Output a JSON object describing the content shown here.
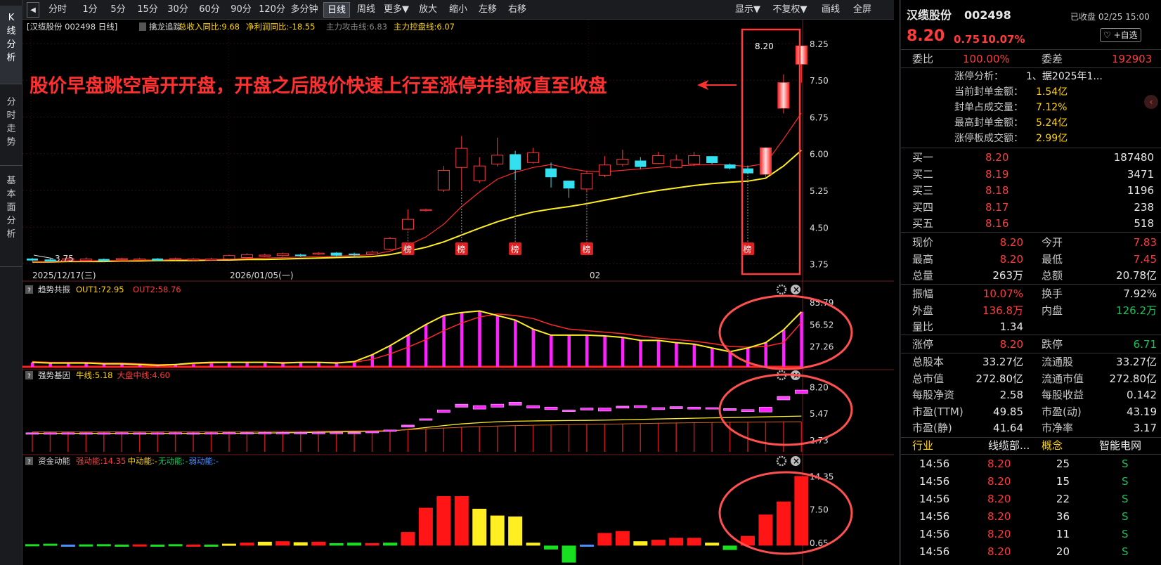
{
  "left_tabs": [
    "K线分析",
    "分时走势",
    "基本面分析"
  ],
  "toolbar": {
    "items": [
      "分时",
      "1分",
      "5分",
      "15分",
      "30分",
      "60分",
      "90分",
      "120分",
      "多分钟",
      "日线",
      "周线",
      "更多▼",
      "放大",
      "缩小",
      "左移",
      "右移"
    ],
    "active": "日线",
    "right_items": [
      "显示▼",
      "不复权▼",
      "画线",
      "全屏"
    ]
  },
  "panes": {
    "main": {
      "header_items": [
        {
          "text": "[汉缆股份 002498 日线]",
          "color": "#dddddd"
        },
        {
          "text": "擒龙追踪",
          "color": "#dddddd"
        },
        {
          "text": "总收入同比:9.68",
          "color": "#ffd400"
        },
        {
          "text": "净利润同比:-18.55",
          "color": "#ffd400"
        },
        {
          "text": "主力攻击线:6.83",
          "color": "#888888"
        },
        {
          "text": "主力控盘线:6.07",
          "color": "#ffd400"
        }
      ],
      "yticks": [
        "8.25",
        "7.50",
        "6.75",
        "6.00",
        "5.25",
        "4.50",
        "3.75"
      ],
      "dates": [
        "2025/12/17(三)",
        "2026/01/05(一)",
        "02"
      ],
      "annotation": "股价早盘跳空高开开盘，开盘之后股价快速上行至涨停并封板直至收盘",
      "last_price_label": "8.20",
      "low_label": "3.75",
      "bang_label": "榜"
    },
    "p1": {
      "name": "趋势共振",
      "v1": "OUT1:72.95",
      "v2": "OUT2:58.76",
      "yticks": [
        "85.79",
        "56.52",
        "27.26"
      ]
    },
    "p2": {
      "name": "强势基因",
      "v1": "牛线:5.18",
      "v2": "大盘中线:4.60",
      "yticks": [
        "8.20",
        "5.47",
        "2.73"
      ]
    },
    "p3": {
      "name": "资金动能",
      "v1": "强动能:14.35",
      "v2": "中动能:-",
      "v3": "无动能:-",
      "v4": "弱动能:-",
      "yticks": [
        "14.35",
        "7.50",
        "0.65"
      ]
    }
  },
  "chart_data": [
    {
      "type": "candlestick",
      "title": "汉缆股份 002498 日线",
      "x": [
        "2025-12-17",
        "2025-12-18",
        "2025-12-19",
        "2025-12-22",
        "2025-12-23",
        "2025-12-24",
        "2025-12-25",
        "2025-12-26",
        "2025-12-29",
        "2025-12-30",
        "2025-12-31",
        "2026-01-05",
        "2026-01-06",
        "2026-01-07",
        "2026-01-08",
        "2026-01-09",
        "2026-01-12",
        "2026-01-13",
        "2026-01-14",
        "2026-01-15",
        "2026-01-16",
        "2026-01-19",
        "2026-01-20",
        "2026-01-21",
        "2026-01-22",
        "2026-01-23",
        "2026-01-26",
        "2026-01-27",
        "2026-01-28",
        "2026-01-29",
        "2026-01-30",
        "2026-02-02",
        "2026-02-03",
        "2026-02-04",
        "2026-02-05",
        "2026-02-06",
        "2026-02-09",
        "2026-02-10",
        "2026-02-11",
        "2026-02-12",
        "2026-02-13",
        "2026-02-23",
        "2026-02-24",
        "2026-02-25"
      ],
      "open": [
        3.86,
        3.84,
        3.83,
        3.82,
        3.85,
        3.84,
        3.84,
        3.86,
        3.85,
        3.84,
        3.83,
        3.85,
        3.88,
        3.91,
        3.92,
        3.94,
        3.95,
        3.98,
        3.96,
        3.95,
        4.05,
        4.46,
        4.84,
        5.26,
        5.72,
        5.45,
        5.79,
        5.99,
        5.82,
        5.7,
        5.45,
        5.28,
        5.56,
        5.78,
        5.86,
        5.8,
        5.72,
        5.79,
        5.95,
        5.78,
        5.7,
        5.58,
        6.93,
        7.83
      ],
      "close": [
        3.82,
        3.8,
        3.86,
        3.85,
        3.81,
        3.86,
        3.85,
        3.82,
        3.86,
        3.85,
        3.85,
        3.92,
        3.94,
        3.93,
        3.96,
        3.91,
        3.97,
        3.92,
        3.93,
        3.99,
        4.27,
        4.66,
        4.86,
        5.66,
        6.11,
        5.75,
        5.97,
        5.67,
        6.02,
        5.52,
        5.29,
        5.6,
        5.77,
        5.89,
        5.73,
        5.96,
        5.87,
        5.96,
        5.81,
        5.7,
        5.6,
        6.12,
        7.45,
        8.2
      ],
      "high": [
        3.87,
        3.86,
        3.88,
        3.88,
        3.86,
        3.88,
        3.87,
        3.87,
        3.88,
        3.87,
        3.87,
        3.94,
        3.97,
        3.96,
        3.98,
        3.96,
        3.99,
        3.99,
        3.98,
        4.02,
        4.3,
        4.86,
        4.88,
        5.75,
        6.36,
        5.93,
        6.33,
        6.06,
        6.12,
        5.82,
        5.43,
        5.65,
        5.95,
        6.08,
        5.93,
        6.04,
        5.98,
        6.04,
        5.95,
        5.8,
        5.76,
        6.13,
        7.62,
        8.2
      ],
      "low": [
        3.8,
        3.78,
        3.81,
        3.81,
        3.79,
        3.82,
        3.82,
        3.8,
        3.82,
        3.81,
        3.81,
        3.83,
        3.86,
        3.89,
        3.9,
        3.89,
        3.93,
        3.9,
        3.91,
        3.93,
        4.03,
        4.44,
        4.82,
        5.22,
        5.25,
        5.4,
        5.74,
        5.46,
        5.8,
        5.31,
        5.1,
        5.21,
        5.52,
        5.74,
        5.68,
        5.79,
        5.7,
        5.75,
        5.79,
        5.68,
        5.58,
        5.53,
        6.82,
        7.45
      ],
      "ma_fast": [
        3.8,
        3.8,
        3.81,
        3.81,
        3.82,
        3.82,
        3.83,
        3.83,
        3.84,
        3.84,
        3.84,
        3.85,
        3.86,
        3.87,
        3.88,
        3.89,
        3.9,
        3.91,
        3.92,
        3.94,
        4.01,
        4.13,
        4.3,
        4.56,
        4.92,
        5.22,
        5.48,
        5.62,
        5.72,
        5.78,
        5.7,
        5.64,
        5.63,
        5.66,
        5.69,
        5.72,
        5.75,
        5.77,
        5.78,
        5.77,
        5.74,
        5.8,
        6.3,
        6.83
      ],
      "ma_slow": [
        3.79,
        3.79,
        3.8,
        3.8,
        3.8,
        3.81,
        3.81,
        3.82,
        3.82,
        3.82,
        3.83,
        3.83,
        3.84,
        3.84,
        3.85,
        3.86,
        3.87,
        3.88,
        3.89,
        3.9,
        3.94,
        4.01,
        4.09,
        4.2,
        4.34,
        4.48,
        4.61,
        4.72,
        4.81,
        4.87,
        4.92,
        4.98,
        5.05,
        5.12,
        5.19,
        5.25,
        5.3,
        5.35,
        5.39,
        5.42,
        5.44,
        5.5,
        5.75,
        6.07
      ],
      "bang_indices": [
        21,
        24,
        27,
        31,
        40
      ],
      "ylim": [
        3.6,
        8.45
      ],
      "yticks": [
        8.25,
        7.5,
        6.75,
        6.0,
        5.25,
        4.5,
        3.75
      ]
    },
    {
      "type": "bar",
      "title": "趋势共振",
      "series": [
        {
          "name": "OUT1",
          "values": [
            6,
            5,
            5,
            5,
            4,
            4,
            3,
            2,
            3,
            5,
            6,
            6,
            6,
            6,
            5,
            6,
            6,
            5,
            7,
            16,
            28,
            42,
            56,
            68,
            72,
            74,
            68,
            62,
            50,
            42,
            42,
            42,
            41,
            39,
            35,
            35,
            32,
            30,
            25,
            20,
            25,
            32,
            49,
            72.95
          ]
        },
        {
          "name": "OUT2",
          "values": [
            7,
            6,
            6,
            6,
            5,
            5,
            4,
            3,
            3,
            4,
            5,
            6,
            6,
            6,
            6,
            6,
            6,
            6,
            6,
            10,
            17,
            26,
            36,
            48,
            58,
            66,
            70,
            68,
            64,
            56,
            50,
            48,
            46,
            44,
            41,
            38,
            36,
            34,
            31,
            27,
            26,
            27,
            32,
            58.76
          ]
        }
      ],
      "ylim": [
        0,
        95
      ],
      "yticks": [
        85.79,
        56.52,
        27.26
      ]
    },
    {
      "type": "bar",
      "title": "强势基因",
      "series": [
        {
          "name": "牛线",
          "values": [
            3.4,
            3.4,
            3.4,
            3.4,
            3.4,
            3.4,
            3.4,
            3.4,
            3.4,
            3.4,
            3.4,
            3.4,
            3.42,
            3.44,
            3.46,
            3.48,
            3.52,
            3.55,
            3.58,
            3.6,
            3.65,
            3.8,
            4.0,
            4.2,
            4.38,
            4.5,
            4.6,
            4.65,
            4.68,
            4.7,
            4.72,
            4.74,
            4.76,
            4.8,
            4.84,
            4.88,
            4.92,
            4.96,
            5.0,
            5.03,
            5.06,
            5.1,
            5.14,
            5.18
          ]
        },
        {
          "name": "大盘中线",
          "values": [
            3.55,
            3.55,
            3.55,
            3.55,
            3.56,
            3.56,
            3.56,
            3.56,
            3.57,
            3.57,
            3.57,
            3.58,
            3.59,
            3.6,
            3.61,
            3.62,
            3.63,
            3.64,
            3.65,
            3.66,
            3.7,
            3.78,
            3.86,
            3.95,
            4.03,
            4.1,
            4.16,
            4.2,
            4.24,
            4.27,
            4.3,
            4.33,
            4.35,
            4.38,
            4.41,
            4.44,
            4.47,
            4.5,
            4.52,
            4.54,
            4.56,
            4.57,
            4.59,
            4.6
          ]
        }
      ],
      "candles_open": [
        3.45,
        3.46,
        3.45,
        3.45,
        3.46,
        3.46,
        3.45,
        3.45,
        3.46,
        3.46,
        3.46,
        3.47,
        3.47,
        3.48,
        3.48,
        3.49,
        3.49,
        3.5,
        3.5,
        3.55,
        3.65,
        4.05,
        4.75,
        5.55,
        6.1,
        5.9,
        6.1,
        6.3,
        6.0,
        5.85,
        5.8,
        5.8,
        5.7,
        6.0,
        6.05,
        5.85,
        5.95,
        5.9,
        5.9,
        5.75,
        5.65,
        5.6,
        6.85,
        7.5
      ],
      "candles_close": [
        3.46,
        3.45,
        3.46,
        3.46,
        3.45,
        3.47,
        3.46,
        3.46,
        3.47,
        3.45,
        3.47,
        3.48,
        3.48,
        3.49,
        3.49,
        3.5,
        3.5,
        3.51,
        3.51,
        3.6,
        3.75,
        4.25,
        4.9,
        5.8,
        6.4,
        6.25,
        6.4,
        6.6,
        6.25,
        6.1,
        5.65,
        6.0,
        6.0,
        6.2,
        6.25,
        6.05,
        6.15,
        6.1,
        6.05,
        5.95,
        5.85,
        6.1,
        7.2,
        7.85
      ],
      "ylim": [
        1.5,
        8.8
      ],
      "yticks": [
        8.2,
        5.47,
        2.73
      ]
    },
    {
      "type": "bar",
      "title": "资金动能",
      "values": [
        0.3,
        0.4,
        0.2,
        0.25,
        0.3,
        0.2,
        0.25,
        0.2,
        0.3,
        0.2,
        0.2,
        0.4,
        0.6,
        0.8,
        0.9,
        0.7,
        0.8,
        0.5,
        0.6,
        0.5,
        0.6,
        2.8,
        7.8,
        10.2,
        10.2,
        7.6,
        6.2,
        6.0,
        0.6,
        -0.8,
        -3.5,
        0.2,
        2.6,
        3.0,
        0.9,
        1.2,
        1.6,
        1.6,
        0.6,
        -0.9,
        2.0,
        6.4,
        9.1,
        14.35
      ],
      "colors": [
        "g",
        "g",
        "b",
        "g",
        "g",
        "g",
        "r",
        "g",
        "g",
        "r",
        "g",
        "y",
        "r",
        "y",
        "r",
        "y",
        "r",
        "g",
        "g",
        "r",
        "g",
        "r",
        "r",
        "r",
        "r",
        "y",
        "y",
        "y",
        "y",
        "g",
        "g",
        "b",
        "r",
        "r",
        "y",
        "r",
        "r",
        "r",
        "y",
        "g",
        "r",
        "r",
        "r",
        "r"
      ],
      "ylim": [
        -4,
        16
      ],
      "yticks": [
        14.35,
        7.5,
        0.65
      ]
    }
  ],
  "quote": {
    "name": "汉缆股份",
    "code": "002498",
    "status": "已收盘 02/25 15:00",
    "price": "8.20",
    "change": "0.75",
    "pct": "10.07%",
    "fav": "♡ +自选",
    "weibi_label": "委比",
    "weibi": "100.00%",
    "weicha_label": "委差",
    "weicha": "192903",
    "zt_lines": [
      {
        "label": "涨停分析：",
        "value": "1、据2025年1..."
      },
      {
        "label": "当前封单金额：",
        "value": "1.54亿"
      },
      {
        "label": "封单占成交量：",
        "value": "7.12%"
      },
      {
        "label": "最高封单金额：",
        "value": "5.24亿"
      },
      {
        "label": "涨停板成交额：",
        "value": "2.99亿"
      }
    ],
    "bids": [
      {
        "label": "买一",
        "price": "8.20",
        "vol": "187480"
      },
      {
        "label": "买二",
        "price": "8.19",
        "vol": "3471"
      },
      {
        "label": "买三",
        "price": "8.18",
        "vol": "1196"
      },
      {
        "label": "买四",
        "price": "8.17",
        "vol": "238"
      },
      {
        "label": "买五",
        "price": "8.16",
        "vol": "518"
      }
    ],
    "stats1": [
      {
        "l1": "现价",
        "v1": "8.20",
        "c1": "red",
        "l2": "今开",
        "v2": "7.83",
        "c2": "red"
      },
      {
        "l1": "最高",
        "v1": "8.20",
        "c1": "red",
        "l2": "最低",
        "v2": "7.45",
        "c2": "red"
      },
      {
        "l1": "总量",
        "v1": "263万",
        "c1": "wht",
        "l2": "总额",
        "v2": "20.78亿",
        "c2": "wht"
      }
    ],
    "stats2": [
      {
        "l1": "振幅",
        "v1": "10.07%",
        "c1": "red",
        "l2": "换手",
        "v2": "7.92%",
        "c2": "wht"
      },
      {
        "l1": "外盘",
        "v1": "136.8万",
        "c1": "red",
        "l2": "内盘",
        "v2": "126.2万",
        "c2": "grn"
      },
      {
        "l1": "量比",
        "v1": "1.34",
        "c1": "wht",
        "l2": "",
        "v2": "",
        "c2": "wht"
      }
    ],
    "stats3": [
      {
        "l1": "涨停",
        "v1": "8.20",
        "c1": "red",
        "l2": "跌停",
        "v2": "6.71",
        "c2": "grn"
      }
    ],
    "stats4": [
      {
        "l1": "总股本",
        "v1": "33.27亿",
        "c1": "wht",
        "l2": "流通股",
        "v2": "33.27亿",
        "c2": "wht"
      },
      {
        "l1": "总市值",
        "v1": "272.80亿",
        "c1": "wht",
        "l2": "流通市值",
        "v2": "272.80亿",
        "c2": "wht"
      },
      {
        "l1": "每股净资",
        "v1": "2.58",
        "c1": "wht",
        "l2": "每股收益",
        "v2": "0.142",
        "c2": "wht"
      },
      {
        "l1": "市盈(TTM)",
        "v1": "49.85",
        "c1": "wht",
        "l2": "市盈(动)",
        "v2": "43.19",
        "c2": "wht"
      },
      {
        "l1": "市盈(静)",
        "v1": "41.64",
        "c1": "wht",
        "l2": "市净率",
        "v2": "3.17",
        "c2": "wht"
      }
    ],
    "industry": {
      "l1": "行业",
      "v1": "线缆部...",
      "l2": "概念",
      "v2": "智能电网"
    },
    "ticks": [
      {
        "time": "14:56",
        "price": "8.20",
        "vol": "25",
        "side": "S"
      },
      {
        "time": "14:56",
        "price": "8.20",
        "vol": "15",
        "side": "S"
      },
      {
        "time": "14:56",
        "price": "8.20",
        "vol": "22",
        "side": "S"
      },
      {
        "time": "14:56",
        "price": "8.20",
        "vol": "36",
        "side": "S"
      },
      {
        "time": "14:56",
        "price": "8.20",
        "vol": "11",
        "side": "S"
      },
      {
        "time": "14:56",
        "price": "8.20",
        "vol": "20",
        "side": "S"
      }
    ]
  },
  "colors": {
    "up": "#ff3b3b",
    "down": "#33e0f0",
    "ma_fast": "#ff2a2a",
    "ma_slow": "#ffee22",
    "magenta": "#ff22ff",
    "highlight": "#ff3b3b",
    "grid": "#3a1414"
  }
}
